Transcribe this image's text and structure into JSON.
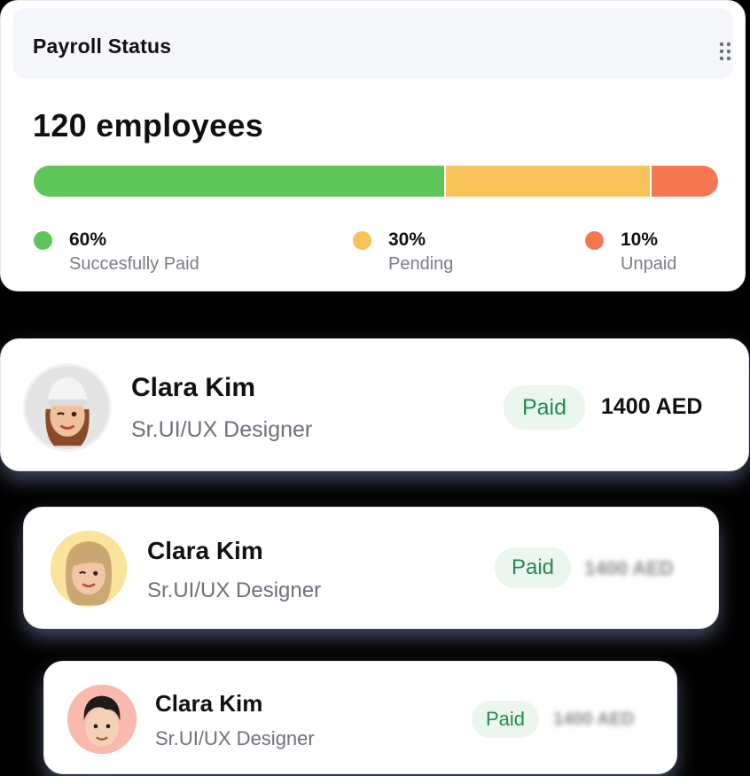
{
  "payroll_status": {
    "title": "Payroll Status",
    "headline": "120 employees",
    "breakdown": [
      {
        "percent_label": "60%",
        "fraction": 0.6,
        "label": "Succesfully Paid",
        "color": "#5ec757"
      },
      {
        "percent_label": "30%",
        "fraction": 0.3,
        "label": "Pending",
        "color": "#f9c35c"
      },
      {
        "percent_label": "10%",
        "fraction": 0.1,
        "label": "Unpaid",
        "color": "#f67852"
      }
    ]
  },
  "employees": [
    {
      "name": "Clara Kim",
      "role": "Sr.UI/UX Designer",
      "status": "Paid",
      "amount": "1400 AED",
      "avatar_icon": "memoji-beanie-avatar-icon"
    },
    {
      "name": "Clara Kim",
      "role": "Sr.UI/UX Designer",
      "status": "Paid",
      "amount": "1400 AED",
      "avatar_icon": "memoji-blonde-avatar-icon"
    },
    {
      "name": "Clara Kim",
      "role": "Sr.UI/UX Designer",
      "status": "Paid",
      "amount": "1400 AED",
      "avatar_icon": "memoji-boy-avatar-icon"
    }
  ]
}
